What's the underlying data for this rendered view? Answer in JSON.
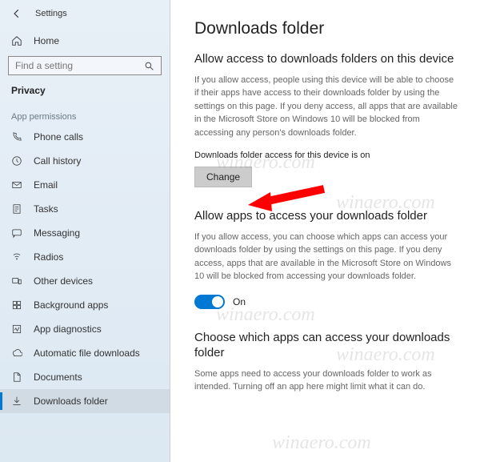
{
  "titlebar": {
    "title": "Settings"
  },
  "sidebar": {
    "home": "Home",
    "search_placeholder": "Find a setting",
    "active_section": "Privacy",
    "section_header": "App permissions",
    "items": [
      {
        "label": "Phone calls"
      },
      {
        "label": "Call history"
      },
      {
        "label": "Email"
      },
      {
        "label": "Tasks"
      },
      {
        "label": "Messaging"
      },
      {
        "label": "Radios"
      },
      {
        "label": "Other devices"
      },
      {
        "label": "Background apps"
      },
      {
        "label": "App diagnostics"
      },
      {
        "label": "Automatic file downloads"
      },
      {
        "label": "Documents"
      },
      {
        "label": "Downloads folder"
      }
    ]
  },
  "main": {
    "page_title": "Downloads folder",
    "section1": {
      "title": "Allow access to downloads folders on this device",
      "desc": "If you allow access, people using this device will be able to choose if their apps have access to their downloads folder by using the settings on this page. If you deny access, all apps that are available in the Microsoft Store on Windows 10 will be blocked from accessing any person's downloads folder.",
      "status": "Downloads folder access for this device is on",
      "change_btn": "Change"
    },
    "section2": {
      "title": "Allow apps to access your downloads folder",
      "desc": "If you allow access, you can choose which apps can access your downloads folder by using the settings on this page. If you deny access, apps that are available in the Microsoft Store on Windows 10 will be blocked from accessing your downloads folder.",
      "toggle_label": "On"
    },
    "section3": {
      "title": "Choose which apps can access your downloads folder",
      "desc": "Some apps need to access your downloads folder to work as intended. Turning off an app here might limit what it can do."
    }
  },
  "watermark": "winaero.com"
}
